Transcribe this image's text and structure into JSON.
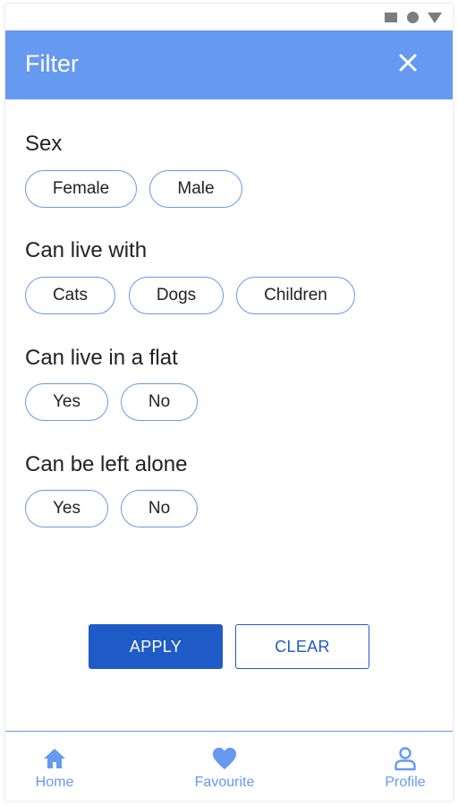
{
  "app_bar": {
    "title": "Filter",
    "close_icon": "close-icon"
  },
  "sections": [
    {
      "title": "Sex",
      "options": [
        "Female",
        "Male"
      ]
    },
    {
      "title": "Can live with",
      "options": [
        "Cats",
        "Dogs",
        "Children"
      ]
    },
    {
      "title": "Can live in a flat",
      "options": [
        "Yes",
        "No"
      ]
    },
    {
      "title": "Can be left alone",
      "options": [
        "Yes",
        "No"
      ]
    }
  ],
  "actions": {
    "apply_label": "APPLY",
    "clear_label": "CLEAR"
  },
  "bottom_nav": [
    {
      "label": "Home",
      "icon": "home-icon"
    },
    {
      "label": "Favourite",
      "icon": "heart-icon"
    },
    {
      "label": "Profile",
      "icon": "profile-icon"
    }
  ],
  "colors": {
    "app_bar": "#6699f0",
    "primary_button": "#1f5bc6",
    "chip_border": "#6d98e6",
    "nav_accent": "#6699f0"
  }
}
